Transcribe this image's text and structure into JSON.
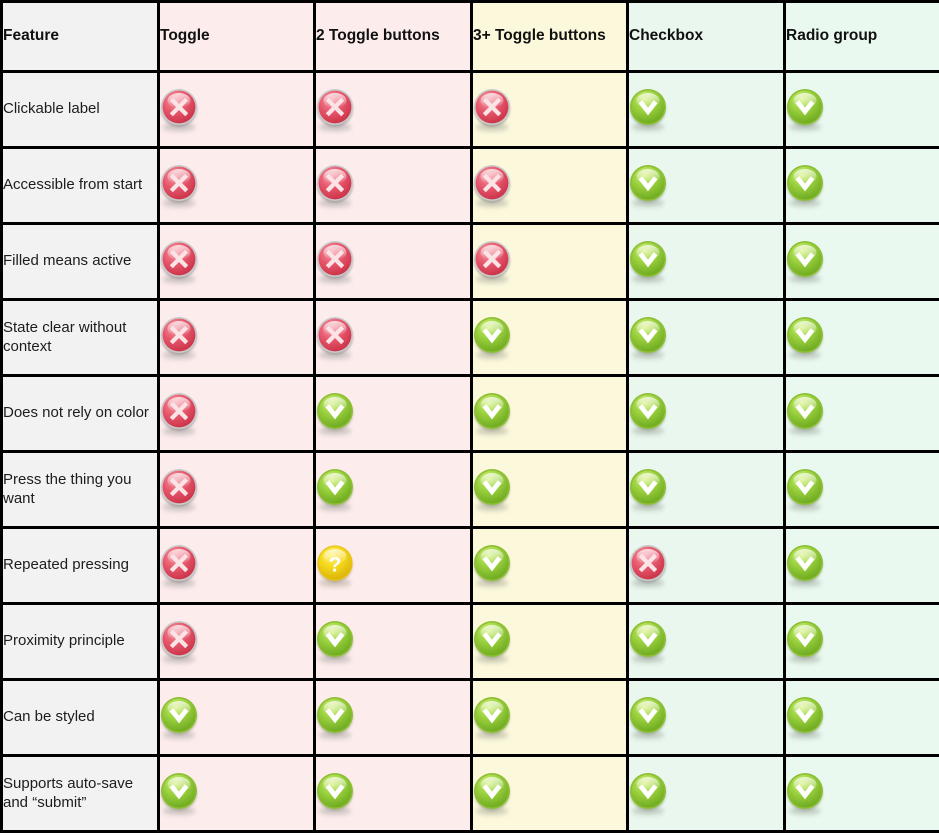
{
  "table": {
    "columns": [
      {
        "key": "feature",
        "label": "Feature",
        "tint": "bg-feature"
      },
      {
        "key": "toggle",
        "label": "Toggle",
        "tint": "bg-pink"
      },
      {
        "key": "two",
        "label": "2 Toggle buttons",
        "tint": "bg-pink"
      },
      {
        "key": "three",
        "label": "3+ Toggle buttons",
        "tint": "bg-yellow"
      },
      {
        "key": "checkbox",
        "label": "Checkbox",
        "tint": "bg-mint"
      },
      {
        "key": "radio",
        "label": "Radio group",
        "tint": "bg-mint2"
      }
    ],
    "rows": [
      {
        "feature": "Clickable label",
        "values": [
          "cross",
          "cross",
          "cross",
          "check",
          "check"
        ]
      },
      {
        "feature": "Accessible from start",
        "values": [
          "cross",
          "cross",
          "cross",
          "check",
          "check"
        ]
      },
      {
        "feature": "Filled means active",
        "values": [
          "cross",
          "cross",
          "cross",
          "check",
          "check"
        ]
      },
      {
        "feature": "State clear without context",
        "values": [
          "cross",
          "cross",
          "check",
          "check",
          "check"
        ]
      },
      {
        "feature": "Does not rely on color",
        "values": [
          "cross",
          "check",
          "check",
          "check",
          "check"
        ]
      },
      {
        "feature": "Press the thing you want",
        "values": [
          "cross",
          "check",
          "check",
          "check",
          "check"
        ]
      },
      {
        "feature": "Repeated pressing",
        "values": [
          "cross",
          "question",
          "check",
          "cross",
          "check"
        ]
      },
      {
        "feature": "Proximity principle",
        "values": [
          "cross",
          "check",
          "check",
          "check",
          "check"
        ]
      },
      {
        "feature": "Can be styled",
        "values": [
          "check",
          "check",
          "check",
          "check",
          "check"
        ]
      },
      {
        "feature": "Supports auto-save and “submit”",
        "values": [
          "check",
          "check",
          "check",
          "check",
          "check"
        ]
      }
    ]
  },
  "icons": {
    "cross": {
      "name": "cross-icon",
      "title": "No",
      "color": "#e04a5f"
    },
    "check": {
      "name": "check-icon",
      "title": "Yes",
      "color": "#8cc63e"
    },
    "question": {
      "name": "question-icon",
      "title": "Maybe",
      "color": "#f2d21a"
    }
  },
  "colors": {
    "grid_line": "#000000",
    "feature_column": "#f2f2f2",
    "pink_column": "#fcecec",
    "yellow_column": "#fcf8dc",
    "mint_column": "#e9f7ee"
  }
}
